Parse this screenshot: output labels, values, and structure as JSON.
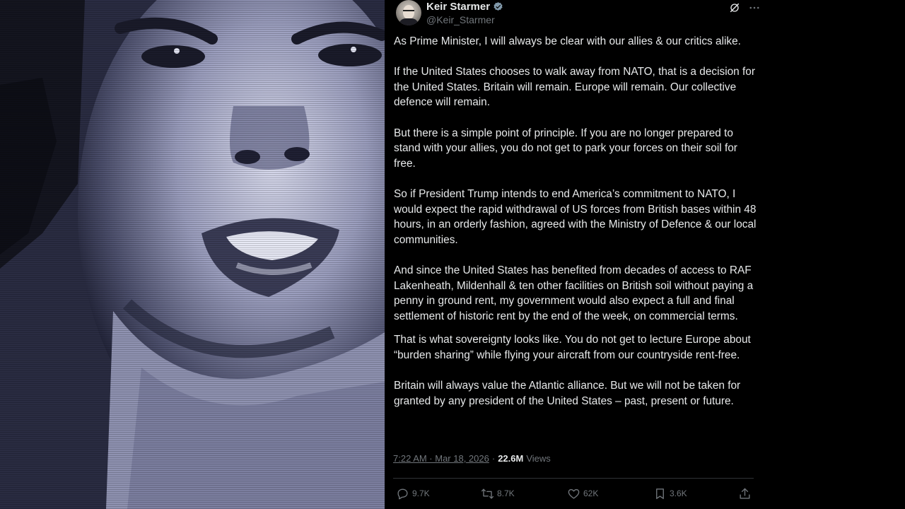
{
  "tweet": {
    "author_name": "Keir Starmer",
    "author_handle": "@Keir_Starmer",
    "paragraphs": [
      "As Prime Minister, I will always be clear with our allies & our critics alike.",
      "If the United States chooses to walk away from NATO, that is a decision for the United States. Britain will remain. Europe will remain. Our collective defence will remain.",
      "But there is a simple point of principle. If you are no longer prepared to stand with your allies, you do not get to park your forces on their soil for free.",
      "So if President Trump intends to end America’s commitment to NATO, I would expect the rapid withdrawal of US forces from British bases within 48 hours, in an orderly fashion, agreed with the Ministry of Defence & our local communities.",
      "And since the United States has benefited from decades of access to RAF Lakenheath, Mildenhall & ten other facilities on British soil without paying a penny in ground rent, my government would also expect a full and final settlement of historic rent by the end of the week, on commercial terms.",
      "That is what sovereignty looks like. You do not get to lecture Europe about “burden sharing” while flying your aircraft from our countryside rent-free.",
      "Britain will always value the Atlantic alliance. But we will not be taken for granted by any president of the United States – past, present or future."
    ],
    "timestamp": "7:22 AM · Mar 18, 2026",
    "separator": "·",
    "views_count": "22.6M",
    "views_label": "Views",
    "replies": "9.7K",
    "reposts": "8.7K",
    "likes": "62K",
    "bookmarks": "3.6K"
  },
  "icons": {
    "verified": "verified-badge-icon",
    "grok": "grok-icon",
    "more": "more-icon",
    "reply": "reply-icon",
    "repost": "repost-icon",
    "like": "heart-icon",
    "bookmark": "bookmark-icon",
    "share": "share-icon"
  },
  "colors": {
    "background": "#000000",
    "text_primary": "#e7e9ea",
    "text_secondary": "#71767b",
    "divider": "#2f3336"
  }
}
